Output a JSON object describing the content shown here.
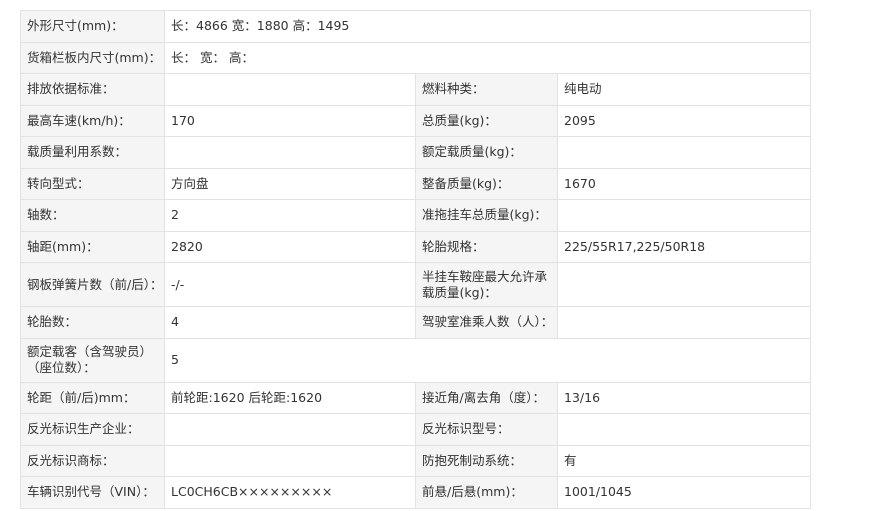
{
  "rows": [
    {
      "l1": "外形尺寸(mm)：",
      "v1": "长：4866 宽：1880 高：1495"
    },
    {
      "l1": "货箱栏板内尺寸(mm)：",
      "v1": "长： 宽： 高："
    },
    {
      "l1": "排放依据标准：",
      "v1": "",
      "l2": "燃料种类：",
      "v2": "纯电动"
    },
    {
      "l1": "最高车速(km/h)：",
      "v1": "170",
      "l2": "总质量(kg)：",
      "v2": "2095"
    },
    {
      "l1": "载质量利用系数：",
      "v1": "",
      "l2": "额定载质量(kg)：",
      "v2": ""
    },
    {
      "l1": "转向型式：",
      "v1": "方向盘",
      "l2": "整备质量(kg)：",
      "v2": "1670"
    },
    {
      "l1": "轴数：",
      "v1": "2",
      "l2": "准拖挂车总质量(kg)：",
      "v2": ""
    },
    {
      "l1": "轴距(mm)：",
      "v1": "2820",
      "l2": "轮胎规格：",
      "v2": "225/55R17,225/50R18"
    },
    {
      "l1": "钢板弹簧片数（前/后）：",
      "v1": "-/-",
      "l2": "半挂车鞍座最大允许承载质量(kg)：",
      "v2": ""
    },
    {
      "l1": "轮胎数：",
      "v1": "4",
      "l2": "驾驶室准乘人数（人）：",
      "v2": ""
    },
    {
      "l1": "额定载客（含驾驶员）（座位数）：",
      "v1": "5"
    },
    {
      "l1": "轮距（前/后)mm：",
      "v1": "前轮距:1620 后轮距:1620",
      "l2": "接近角/离去角（度）：",
      "v2": "13/16"
    },
    {
      "l1": "反光标识生产企业：",
      "v1": "",
      "l2": "反光标识型号：",
      "v2": ""
    },
    {
      "l1": "反光标识商标：",
      "v1": "",
      "l2": "防抱死制动系统：",
      "v2": "有"
    },
    {
      "l1": "车辆识别代号（VIN）：",
      "v1": "LC0CH6CB×××××××××",
      "l2": "前悬/后悬(mm)：",
      "v2": "1001/1045"
    }
  ]
}
